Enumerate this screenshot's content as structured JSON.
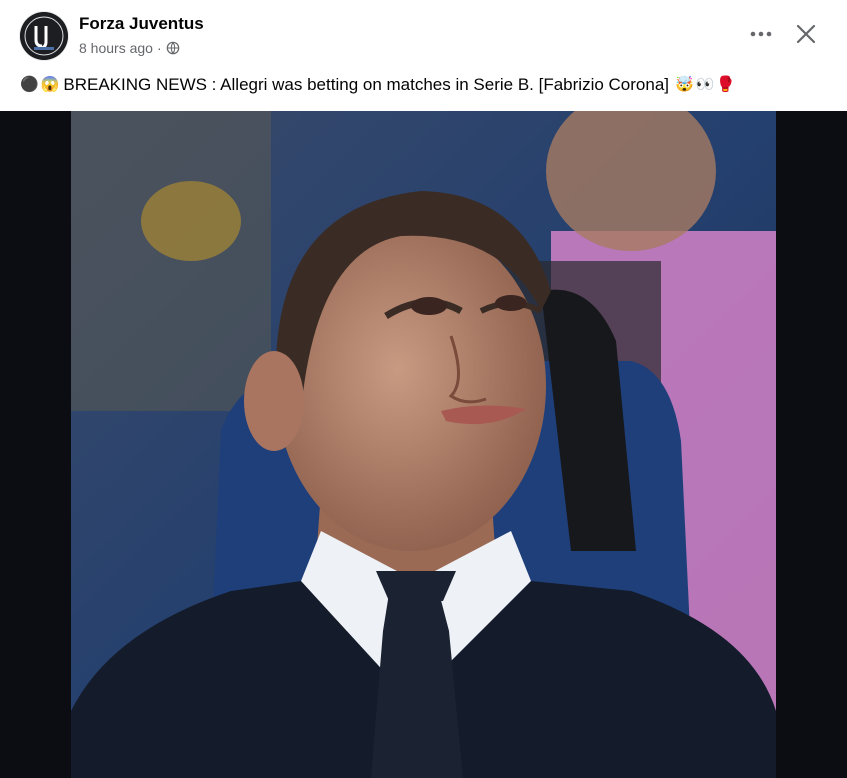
{
  "post": {
    "page_name": "Forza Juventus",
    "timestamp": "8 hours ago",
    "separator": "·",
    "audience_icon": "globe-icon",
    "more_icon": "more-options-icon",
    "close_icon": "close-icon",
    "text": "BREAKING NEWS : Allegri was betting on matches in Serie B. [Fabrizio Corona]",
    "leading_emojis": [
      "⚫",
      "😱"
    ],
    "trailing_emojis": [
      "🤯",
      "👀",
      "🥊"
    ]
  },
  "media": {
    "type": "photo",
    "background_color": "#0b0d12"
  },
  "colors": {
    "name_text": "#050505",
    "meta_text": "#65676b",
    "avatar_bg": "#1c1e21"
  }
}
